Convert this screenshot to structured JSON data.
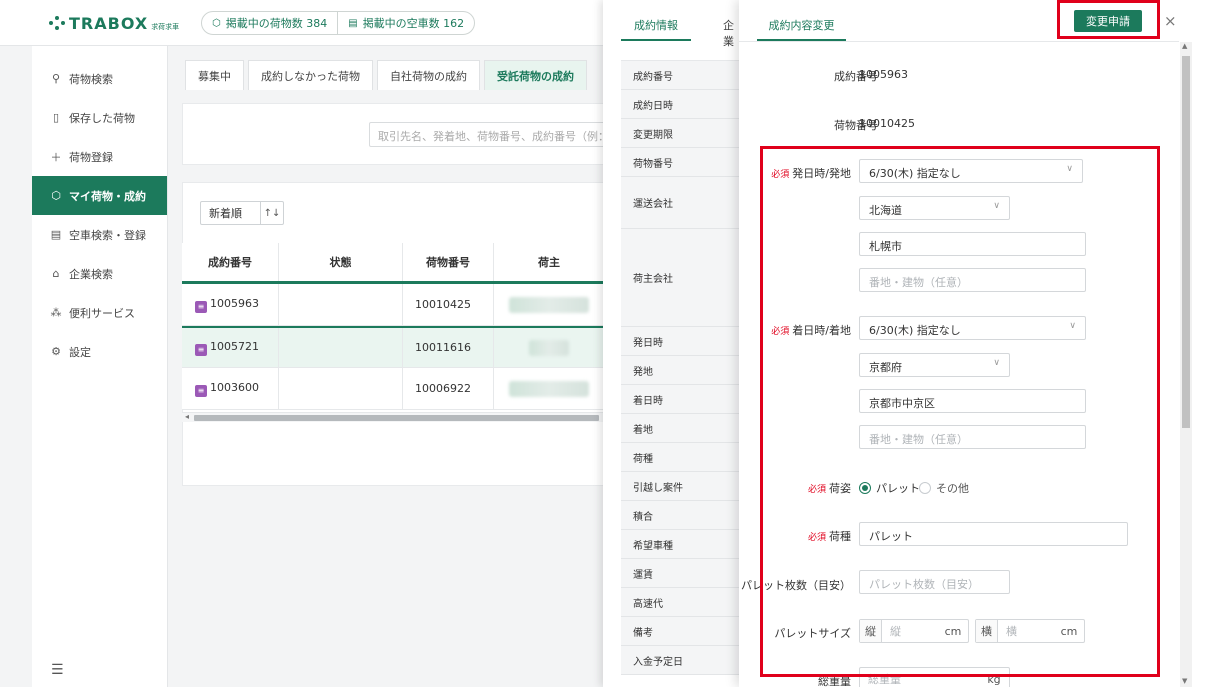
{
  "app": {
    "logo_text": "TRABOX",
    "logo_sub": "求荷求車",
    "stats": [
      {
        "label": "掲載中の荷物数 384",
        "icon": "cube-icon"
      },
      {
        "label": "掲載中の空車数 162",
        "icon": "truck-icon"
      }
    ]
  },
  "sidebar": {
    "items": [
      {
        "label": "荷物検索",
        "icon": "search-icon"
      },
      {
        "label": "保存した荷物",
        "icon": "bookmark-icon"
      },
      {
        "label": "荷物登録",
        "icon": "plus-icon"
      },
      {
        "label": "マイ荷物・成約",
        "icon": "cube-icon",
        "active": true
      },
      {
        "label": "空車検索・登録",
        "icon": "truck-icon"
      },
      {
        "label": "企業検索",
        "icon": "home-icon"
      },
      {
        "label": "便利サービス",
        "icon": "network-icon"
      },
      {
        "label": "設定",
        "icon": "gear-icon"
      }
    ]
  },
  "main": {
    "tabs": [
      "募集中",
      "成約しなかった荷物",
      "自社荷物の成約",
      "受託荷物の成約"
    ],
    "active_tab": 3,
    "search_placeholder": "取引先名、発着地、荷物番号、成約番号（例：東京",
    "sort_label": "新着順",
    "table": {
      "headers": [
        "成約番号",
        "状態",
        "荷物番号",
        "荷主"
      ],
      "rows": [
        {
          "contract_no": "1005963",
          "status": "",
          "cargo_no": "10010425"
        },
        {
          "contract_no": "1005721",
          "status": "",
          "cargo_no": "10011616"
        },
        {
          "contract_no": "1003600",
          "status": "",
          "cargo_no": "10006922"
        }
      ]
    }
  },
  "mid_panel": {
    "tab_active": "成約情報",
    "tab_other": "企業",
    "rows": [
      {
        "label": "成約番号",
        "height": 29
      },
      {
        "label": "成約日時",
        "height": 29
      },
      {
        "label": "変更期限",
        "height": 29
      },
      {
        "label": "荷物番号",
        "height": 29
      },
      {
        "label": "運送会社",
        "height": 52
      },
      {
        "label": "荷主会社",
        "height": 98
      },
      {
        "label": "発日時",
        "height": 29
      },
      {
        "label": "発地",
        "height": 29
      },
      {
        "label": "着日時",
        "height": 29
      },
      {
        "label": "着地",
        "height": 29
      },
      {
        "label": "荷種",
        "height": 29
      },
      {
        "label": "引越し案件",
        "height": 29
      },
      {
        "label": "積合",
        "height": 29
      },
      {
        "label": "希望車種",
        "height": 29
      },
      {
        "label": "運賃",
        "height": 29
      },
      {
        "label": "高速代",
        "height": 29
      },
      {
        "label": "備考",
        "height": 29
      },
      {
        "label": "入金予定日",
        "height": 29
      }
    ]
  },
  "drawer": {
    "tab": "成約内容変更",
    "apply_button": "変更申請",
    "close": "×",
    "required": "必須",
    "contract_no_label": "成約番号",
    "contract_no": "1005963",
    "cargo_no_label": "荷物番号",
    "cargo_no": "10010425",
    "depart": {
      "label": "発日時/発地",
      "datetime": "6/30(木) 指定なし",
      "prefecture": "北海道",
      "city": "札幌市",
      "address_placeholder": "番地・建物（任意）"
    },
    "arrive": {
      "label": "着日時/着地",
      "datetime": "6/30(木) 指定なし",
      "prefecture": "京都府",
      "city": "京都市中京区",
      "address_placeholder": "番地・建物（任意）"
    },
    "packing": {
      "label": "荷姿",
      "options": [
        "パレット",
        "その他"
      ],
      "selected": "パレット"
    },
    "cargo_type": {
      "label": "荷種",
      "value": "パレット"
    },
    "pallet_count": {
      "label": "パレット枚数（目安）",
      "placeholder": "パレット枚数（目安）"
    },
    "pallet_size": {
      "label": "パレットサイズ",
      "length": {
        "prefix": "縦",
        "placeholder": "縦",
        "unit": "cm"
      },
      "width": {
        "prefix": "横",
        "placeholder": "横",
        "unit": "cm"
      }
    },
    "total_weight": {
      "label": "総重量",
      "placeholder": "総重量",
      "unit": "kg"
    }
  },
  "colors": {
    "accent": "#1c7a5c",
    "highlight": "#e0001b",
    "badge": "#9b59b6"
  }
}
